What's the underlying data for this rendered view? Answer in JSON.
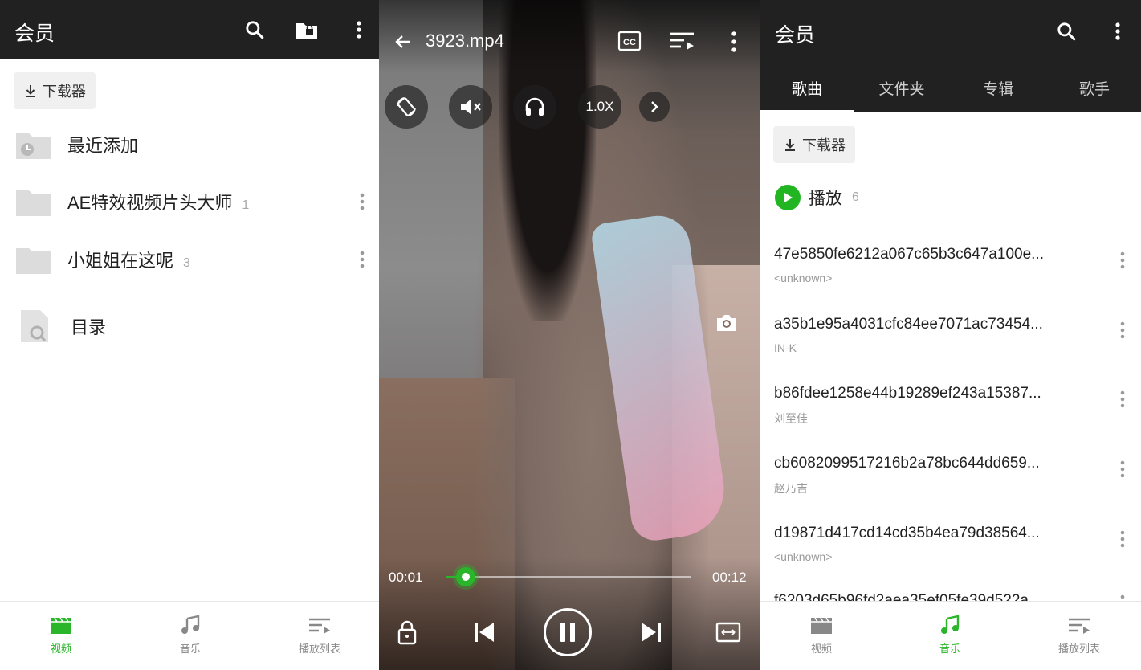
{
  "left": {
    "title": "会员",
    "downloader_label": "下载器",
    "rows": [
      {
        "label": "最近添加",
        "count": ""
      },
      {
        "label": "AE特效视频片头大师",
        "count": "1"
      },
      {
        "label": "小姐姐在这呢",
        "count": "3"
      },
      {
        "label": "目录",
        "count": ""
      }
    ],
    "nav": [
      {
        "label": "视频",
        "icon": "video-icon",
        "active": true
      },
      {
        "label": "音乐",
        "icon": "music-icon",
        "active": false
      },
      {
        "label": "播放列表",
        "icon": "playlist-icon",
        "active": false
      }
    ]
  },
  "player": {
    "filename": "3923.mp4",
    "speed": "1.0X",
    "current_time": "00:01",
    "total_time": "00:12",
    "progress": 0.08
  },
  "right": {
    "title": "会员",
    "tabs": [
      "歌曲",
      "文件夹",
      "专辑",
      "歌手"
    ],
    "active_tab": 0,
    "downloader_label": "下载器",
    "play_label": "播放",
    "play_count": "6",
    "songs": [
      {
        "title": "47e5850fe6212a067c65b3c647a100e...",
        "artist": "<unknown>"
      },
      {
        "title": "a35b1e95a4031cfc84ee7071ac73454...",
        "artist": "IN-K"
      },
      {
        "title": "b86fdee1258e44b19289ef243a15387...",
        "artist": "刘至佳"
      },
      {
        "title": "cb6082099517216b2a78bc644dd659...",
        "artist": "赵乃吉"
      },
      {
        "title": "d19871d417cd14cd35b4ea79d38564...",
        "artist": "<unknown>"
      },
      {
        "title": "f6203d65b96fd2aea35ef05fe39d522a",
        "artist": ""
      }
    ],
    "nav": [
      {
        "label": "视频",
        "icon": "video-icon",
        "active": false
      },
      {
        "label": "音乐",
        "icon": "music-icon",
        "active": true
      },
      {
        "label": "播放列表",
        "icon": "playlist-icon",
        "active": false
      }
    ]
  },
  "colors": {
    "accent": "#2ab52a",
    "appbar": "#212121"
  }
}
